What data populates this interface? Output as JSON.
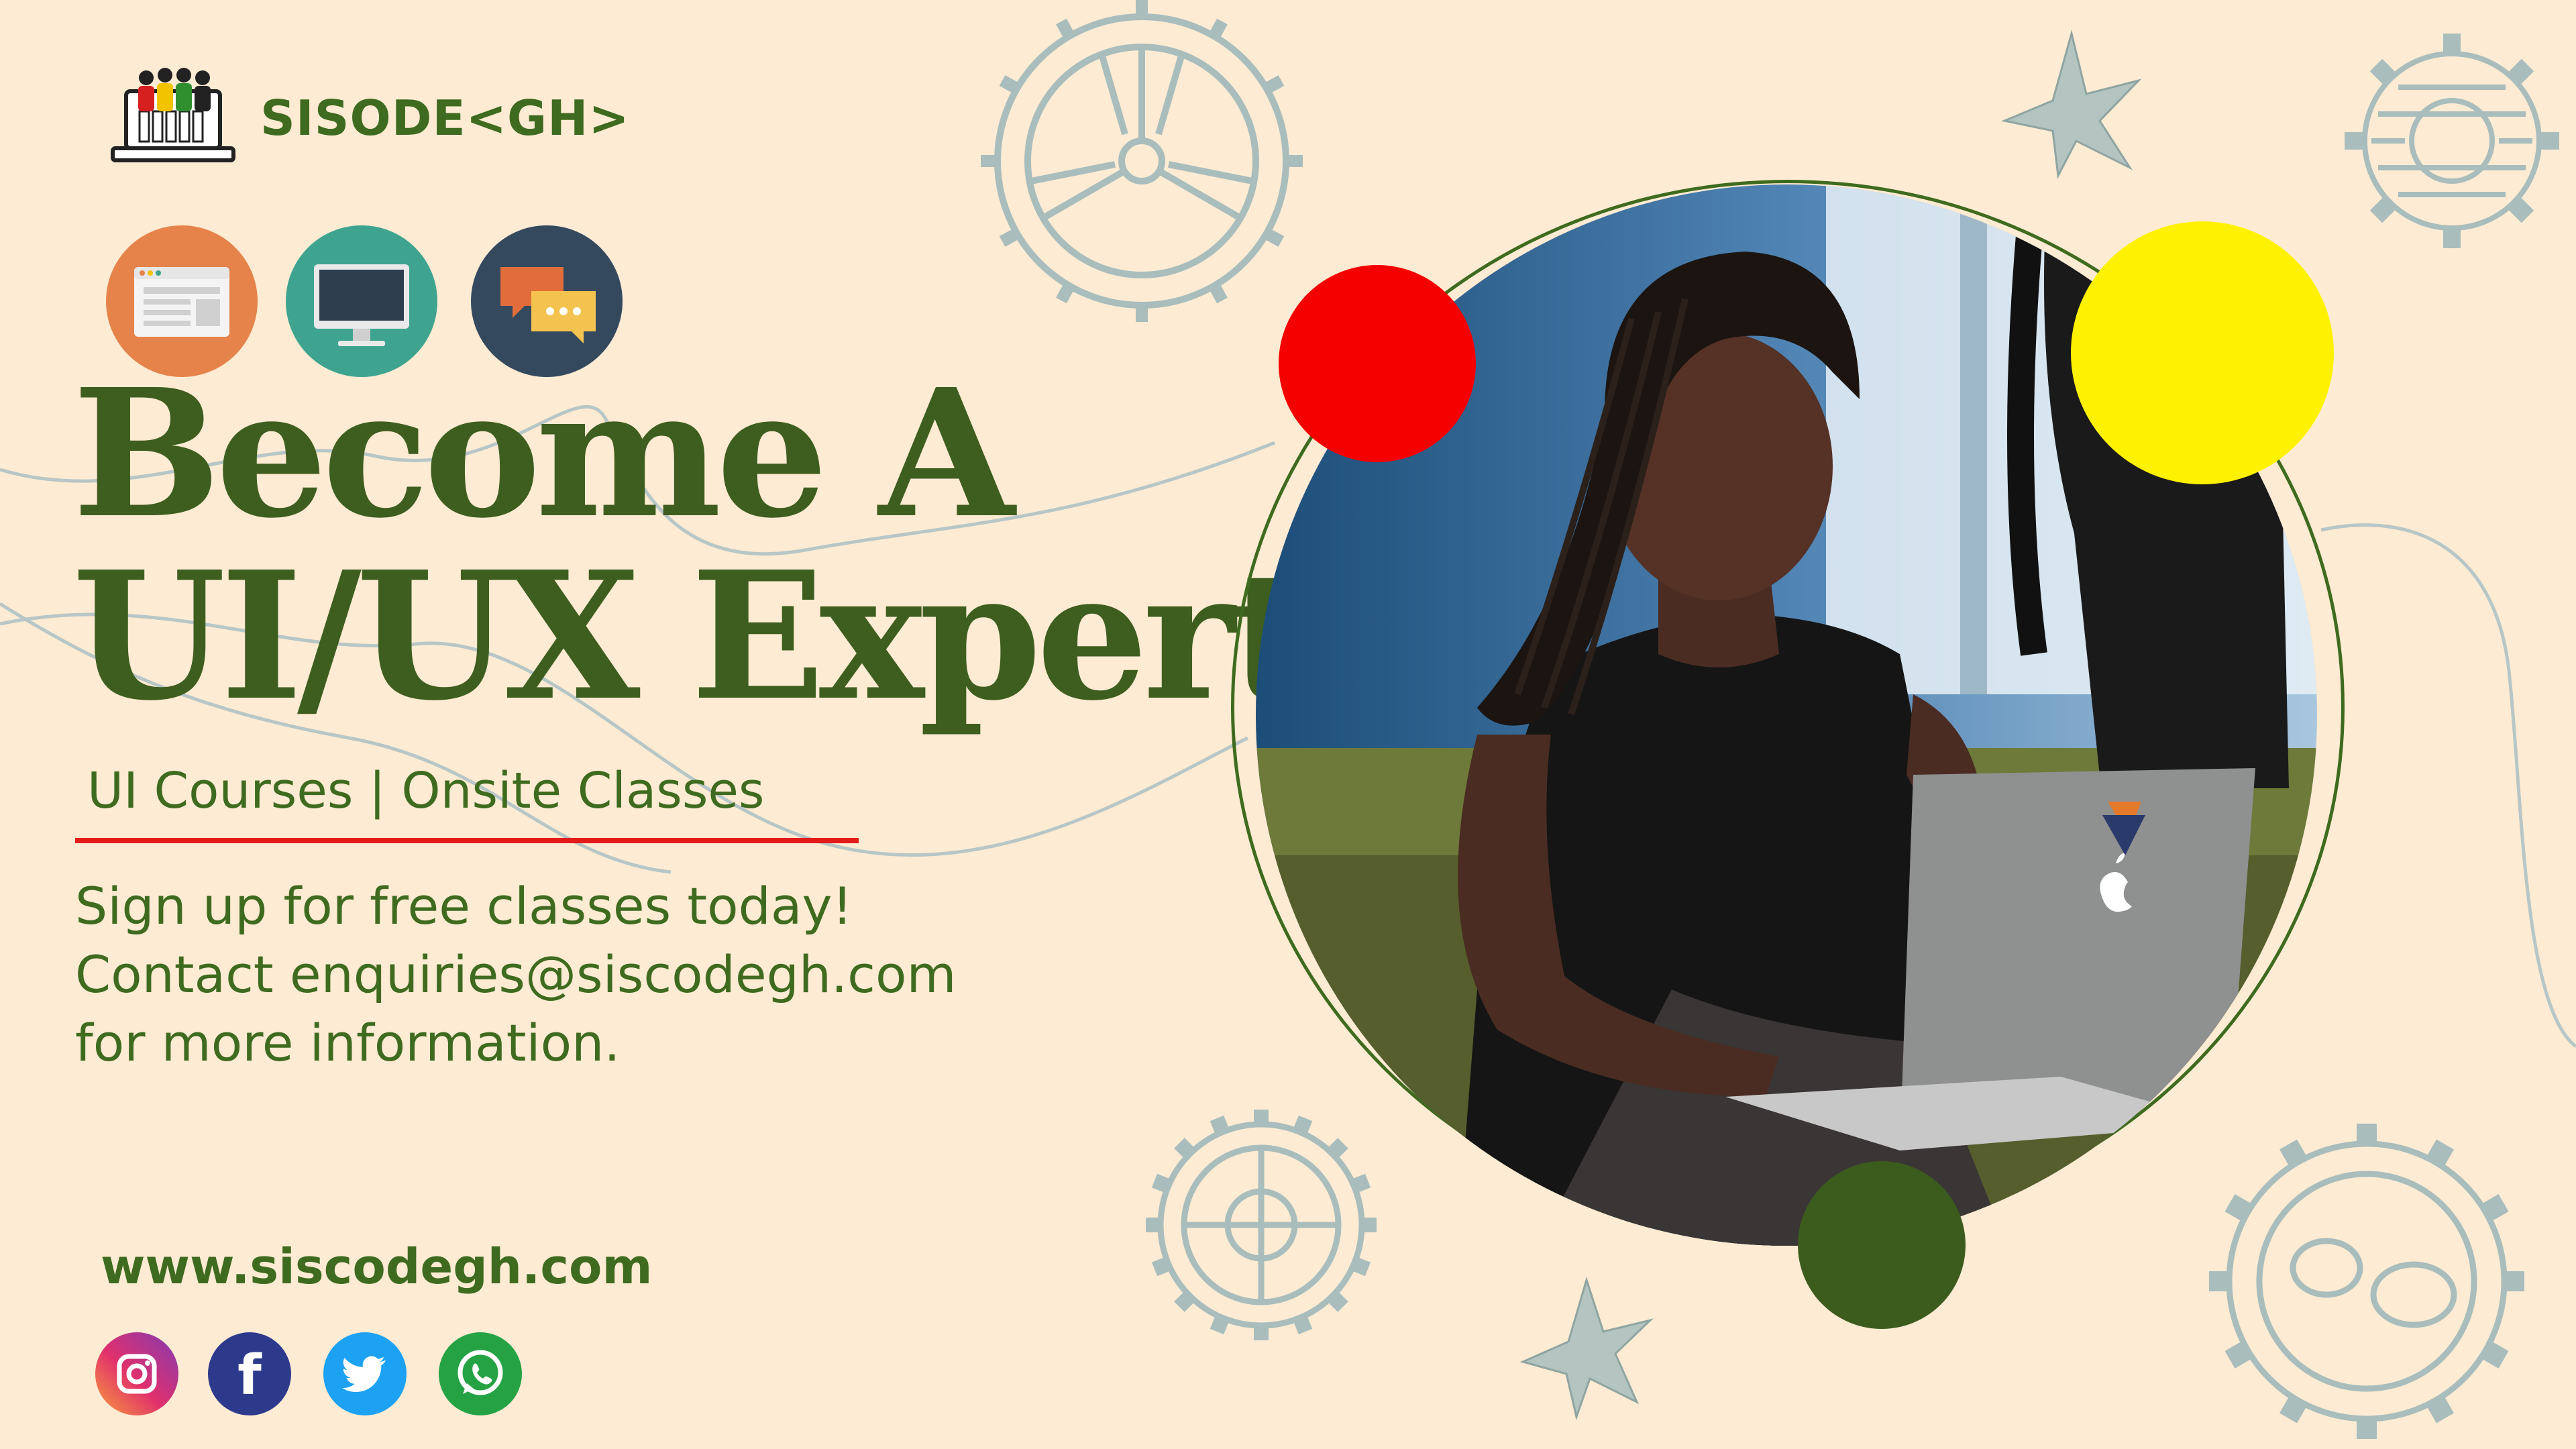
{
  "brand": {
    "name": "SISODE<GH>"
  },
  "features": [
    {
      "icon": "browser-window-icon",
      "color": "#e5834a"
    },
    {
      "icon": "desktop-monitor-icon",
      "color": "#3fa48f"
    },
    {
      "icon": "chat-bubbles-icon",
      "color": "#34495e"
    }
  ],
  "headline": {
    "line1": "Become A",
    "line2": "UI/UX Expert"
  },
  "subtitle": "UI Courses | Onsite Classes",
  "signup": {
    "line1": "Sign up for free classes today!",
    "line2": "Contact enquiries@siscodegh.com",
    "line3": "for more information."
  },
  "website": "www.siscodegh.com",
  "social": [
    {
      "icon": "instagram-icon"
    },
    {
      "icon": "facebook-icon",
      "letter": "f"
    },
    {
      "icon": "twitter-icon"
    },
    {
      "icon": "whatsapp-icon"
    }
  ],
  "colors": {
    "background": "#fdebd3",
    "brand_green": "#3e6b1f",
    "accent_red": "#f50000",
    "accent_yellow": "#fff200",
    "gear_gray": "#a9bdbd"
  }
}
